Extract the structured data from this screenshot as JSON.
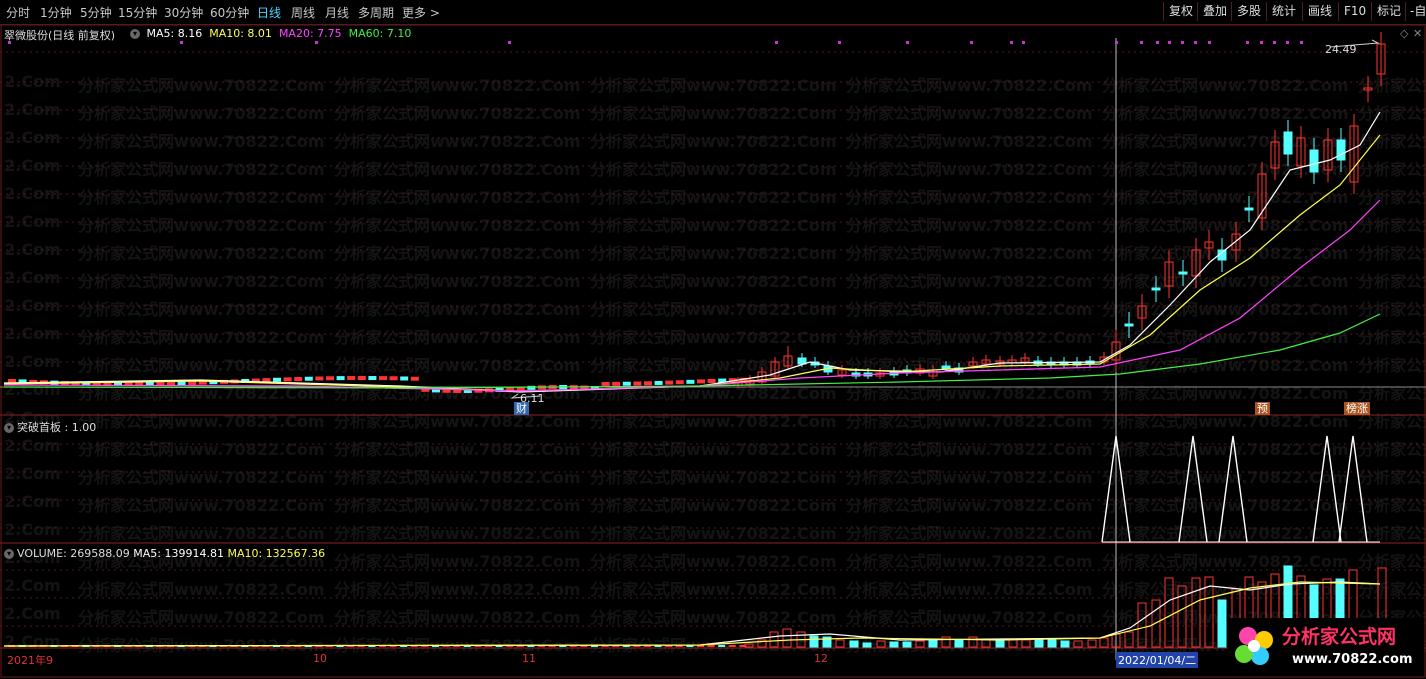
{
  "toolbar": {
    "periods": [
      "分时",
      "1分钟",
      "5分钟",
      "15分钟",
      "30分钟",
      "60分钟",
      "日线",
      "周线",
      "月线",
      "多周期",
      "更多 >"
    ],
    "active": "日线",
    "right_buttons": [
      "复权",
      "叠加",
      "多股",
      "统计",
      "画线",
      "F10",
      "标记",
      "-自"
    ]
  },
  "main_pane": {
    "stock_title": "翠微股份(日线 前复权)",
    "ma": [
      {
        "label": "MA5: 8.16",
        "color": "#ffffff"
      },
      {
        "label": "MA10: 8.01",
        "color": "#ffff55"
      },
      {
        "label": "MA20: 7.75",
        "color": "#ff44ff"
      },
      {
        "label": "MA60: 7.10",
        "color": "#44ee44"
      }
    ],
    "high_label": "24.49",
    "low_label": "6.11",
    "badge_cai": "财",
    "badge_yu": "预",
    "badge_bangzhang": "榜涨"
  },
  "indicator_pane": {
    "label": "突破首板 : 1.00"
  },
  "volume_pane": {
    "label_volume": "VOLUME: 269588.09",
    "label_ma5": "MA5: 139914.81",
    "label_ma10": "MA10: 132567.36"
  },
  "x_axis": {
    "labels": [
      "2021年9",
      "10",
      "11",
      "12"
    ],
    "cursor_date": "2022/01/04/二"
  },
  "watermark": {
    "text": "分析家公式网www.70822.Com",
    "edge": "2.Com"
  },
  "logo": {
    "title": "分析家公式网",
    "url": "www.70822.com"
  },
  "colors": {
    "up": "#ff3333",
    "down": "#55ffff",
    "ma5": "#ffffff",
    "ma10": "#ffff55",
    "ma20": "#ff44ff",
    "ma60": "#44ee44"
  }
}
